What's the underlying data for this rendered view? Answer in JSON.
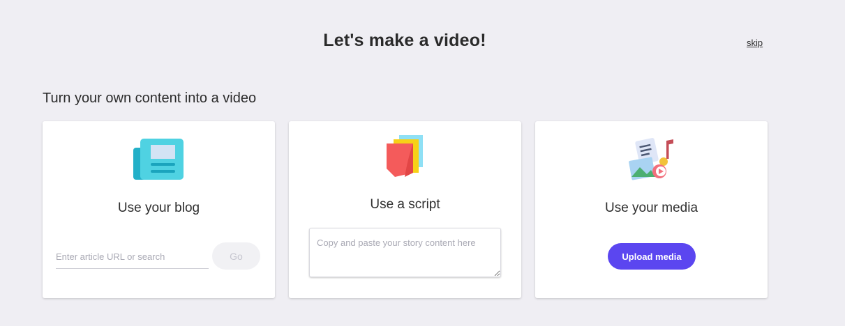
{
  "header": {
    "title": "Let's make a video!",
    "skip_label": "skip"
  },
  "section": {
    "title": "Turn your own content into a video"
  },
  "cards": {
    "blog": {
      "label": "Use your blog",
      "icon": "newspaper-icon",
      "input_placeholder": "Enter article URL or search",
      "input_value": "",
      "go_label": "Go"
    },
    "script": {
      "label": "Use a script",
      "icon": "script-pages-icon",
      "textarea_placeholder": "Copy and paste your story content here",
      "textarea_value": ""
    },
    "media": {
      "label": "Use your media",
      "icon": "media-collage-icon",
      "upload_label": "Upload media"
    }
  },
  "colors": {
    "background": "#efeef3",
    "accent": "#5b46f0",
    "card": "#ffffff"
  }
}
